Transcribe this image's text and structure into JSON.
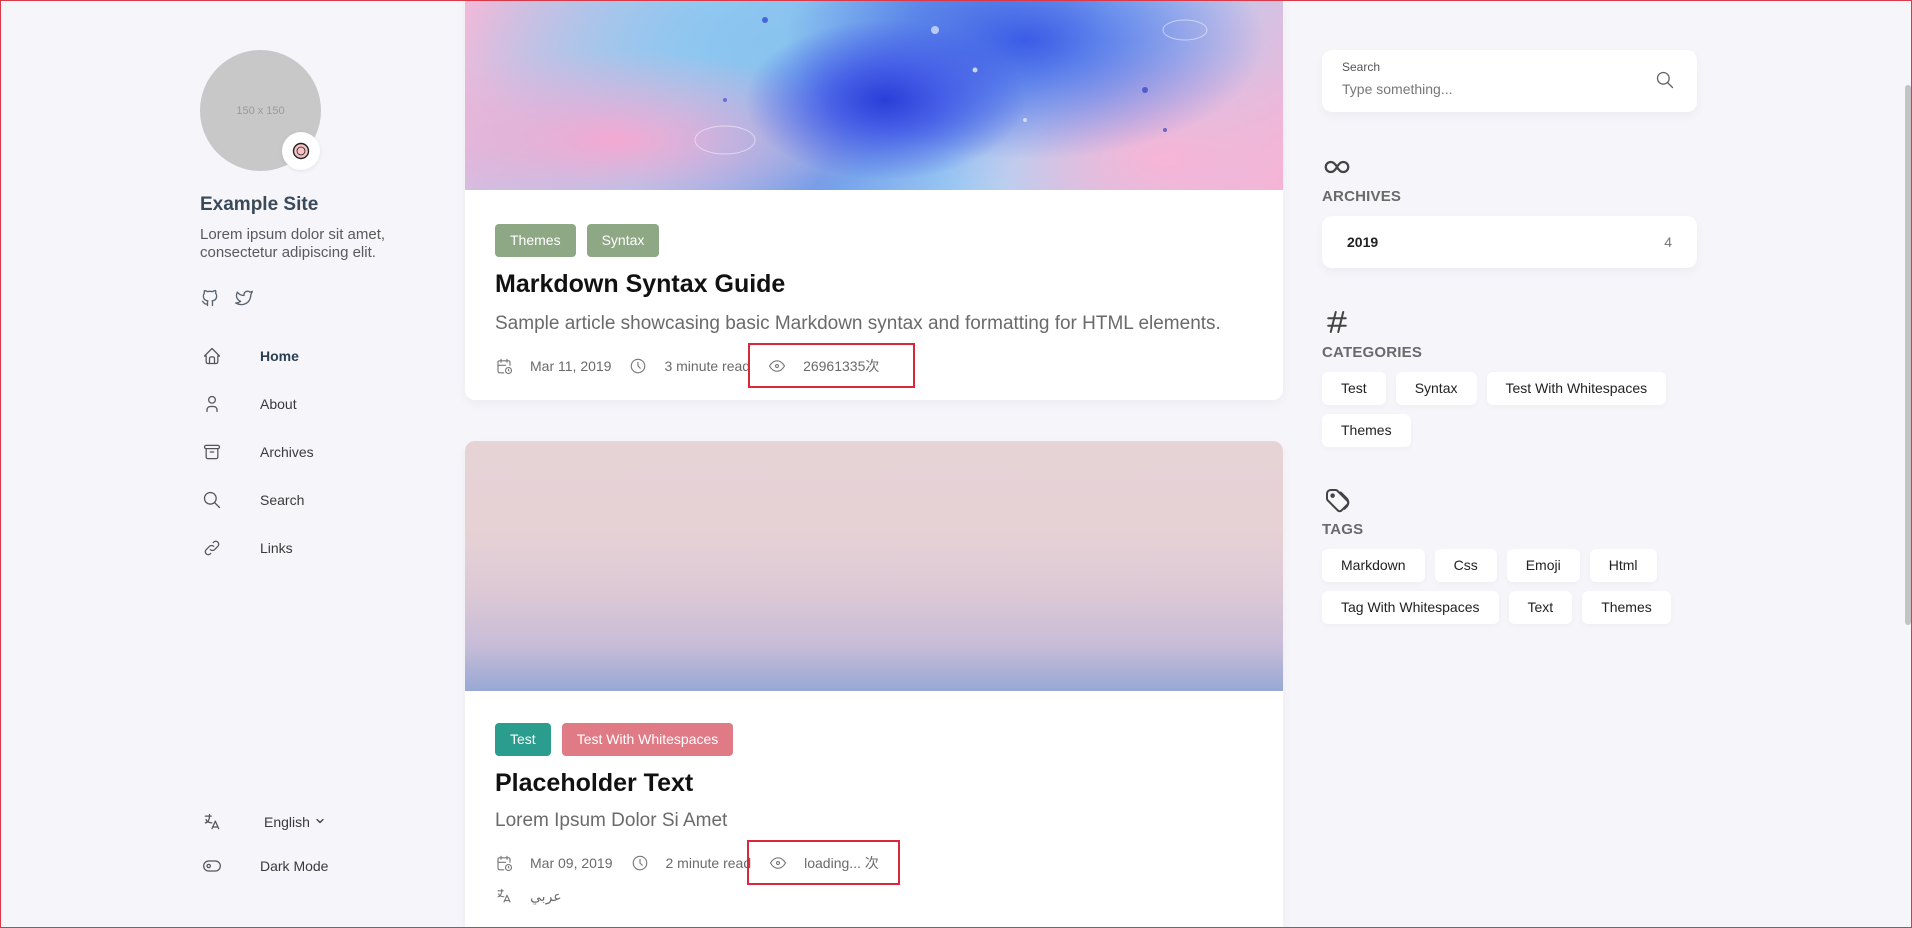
{
  "site": {
    "avatar_placeholder": "150 x 150",
    "avatar_emoji_icon": "emoji-icon",
    "name": "Example Site",
    "description": "Lorem ipsum dolor sit amet, consectetur adipiscing elit."
  },
  "social": [
    {
      "name": "GitHub",
      "icon": "github-icon"
    },
    {
      "name": "Twitter",
      "icon": "twitter-icon"
    }
  ],
  "menu": [
    {
      "label": "Home",
      "icon": "home-icon",
      "active": true
    },
    {
      "label": "About",
      "icon": "user-icon"
    },
    {
      "label": "Archives",
      "icon": "archive-icon"
    },
    {
      "label": "Search",
      "icon": "search-icon"
    },
    {
      "label": "Links",
      "icon": "link-icon"
    }
  ],
  "bottom": {
    "language": "English",
    "dark_mode": "Dark Mode"
  },
  "articles": [
    {
      "tags": [
        {
          "label": "Themes",
          "color": "#8ea885"
        },
        {
          "label": "Syntax",
          "color": "#8ea885"
        }
      ],
      "title": "Markdown Syntax Guide",
      "subtitle": "Sample article showcasing basic Markdown syntax and formatting for HTML elements.",
      "date": "Mar 11, 2019",
      "read_time": "3 minute read",
      "views": "26961335次"
    },
    {
      "tags": [
        {
          "label": "Test",
          "color": "#2a9d8f"
        },
        {
          "label": "Test With Whitespaces",
          "color": "#e07a85"
        }
      ],
      "title": "Placeholder Text",
      "subtitle": "Lorem Ipsum Dolor Si Amet",
      "date": "Mar 09, 2019",
      "read_time": "2 minute read",
      "views": "loading... 次",
      "translation": "عربي"
    }
  ],
  "search": {
    "label": "Search",
    "placeholder": "Type something..."
  },
  "archives": {
    "title": "ARCHIVES",
    "items": [
      {
        "year": "2019",
        "count": "4"
      }
    ]
  },
  "categories": {
    "title": "CATEGORIES",
    "items": [
      "Test",
      "Syntax",
      "Test With Whitespaces",
      "Themes"
    ]
  },
  "tags": {
    "title": "TAGS",
    "items": [
      "Markdown",
      "Css",
      "Emoji",
      "Html",
      "Tag With Whitespaces",
      "Text",
      "Themes"
    ]
  }
}
